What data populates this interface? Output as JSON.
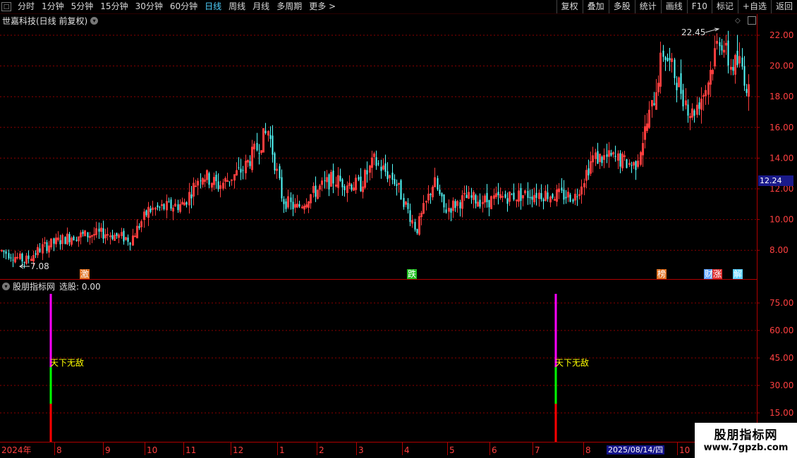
{
  "toolbar": {
    "left_items": [
      {
        "label": "分时",
        "active": false
      },
      {
        "label": "1分钟",
        "active": false
      },
      {
        "label": "5分钟",
        "active": false
      },
      {
        "label": "15分钟",
        "active": false
      },
      {
        "label": "30分钟",
        "active": false
      },
      {
        "label": "60分钟",
        "active": false
      },
      {
        "label": "日线",
        "active": true
      },
      {
        "label": "周线",
        "active": false
      },
      {
        "label": "月线",
        "active": false
      },
      {
        "label": "多周期",
        "active": false
      },
      {
        "label": "更多 >",
        "active": false
      }
    ],
    "right_items": [
      "复权",
      "叠加",
      "多股",
      "统计",
      "画线",
      "F10",
      "标记",
      "+自选",
      "返回"
    ]
  },
  "chart": {
    "title": "世嘉科技(日线 前复权)",
    "high_label": "22.45",
    "low_label": "7.08",
    "last_price": "12.24",
    "price_axis": [
      "22.00",
      "20.00",
      "18.00",
      "16.00",
      "14.00",
      "12.00",
      "10.00",
      "8.00"
    ],
    "badges": [
      {
        "text": "激",
        "color": "#e07020"
      },
      {
        "text": "跌",
        "color": "#20c020"
      },
      {
        "text": "榜",
        "color": "#e07020"
      },
      {
        "text": "财",
        "color": "#5aa0ff"
      },
      {
        "text": "涨",
        "color": "#e03030"
      },
      {
        "text": "解",
        "color": "#5ad0ff"
      }
    ]
  },
  "indicator": {
    "name": "股朋指标网",
    "value_label": "选股: 0.00",
    "axis": [
      "75.00",
      "60.00",
      "45.00",
      "30.00",
      "15.00"
    ],
    "signals": [
      {
        "label": "天下无敌"
      },
      {
        "label": "天下无敌"
      }
    ]
  },
  "time_axis": {
    "labels": [
      "2024年",
      "8",
      "9",
      "10",
      "11",
      "12",
      "1",
      "2",
      "3",
      "4",
      "5",
      "6",
      "7",
      "8",
      "10"
    ],
    "highlight": "2025/08/14/四"
  },
  "watermark": {
    "line1": "股朋指标网",
    "line2": "www.7gpzb.com"
  },
  "colors": {
    "up": "#ff3d3d",
    "down": "#54ffff",
    "grid": "#8b0000",
    "signal_top": "#ff00ff",
    "signal_mid": "#00ff00",
    "signal_bot": "#ff0000",
    "label": "#ffff00"
  }
}
